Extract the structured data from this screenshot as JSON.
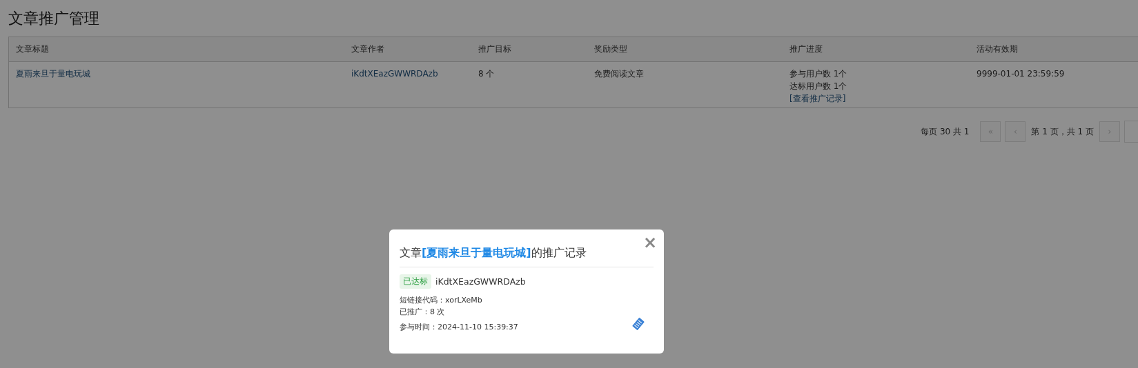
{
  "page_title": "文章推广管理",
  "table": {
    "columns": [
      "文章标题",
      "文章作者",
      "推广目标",
      "奖励类型",
      "推广进度",
      "活动有效期"
    ],
    "rows": [
      {
        "title": "夏雨来旦于量电玩城",
        "author": "iKdtXEazGWWRDAzb",
        "target": "8 个",
        "reward": "免费阅读文章",
        "progress": [
          "参与用户数 1个",
          "达标用户数 1个"
        ],
        "progress_link": "[查看推广记录]",
        "valid_until": "9999-01-01 23:59:59"
      }
    ]
  },
  "pagination": {
    "summary": "每页 30 共 1",
    "items": [
      {
        "kind": "button",
        "label": "«",
        "disabled": true
      },
      {
        "kind": "button",
        "label": "‹",
        "disabled": true
      },
      {
        "kind": "text",
        "label": "第 1 页，共 1 页"
      },
      {
        "kind": "button",
        "label": "›",
        "disabled": true
      },
      {
        "kind": "edge"
      }
    ]
  },
  "modal": {
    "title_prefix": "文章",
    "title_link": "[夏雨来旦于量电玩城]",
    "title_suffix": "的推广记录",
    "close": "×",
    "records": [
      {
        "badge": "已达标",
        "user": "iKdtXEazGWWRDAzb",
        "lines": [
          "短链接代码：xorLXeMb",
          "已推广：8 次"
        ],
        "time": "参与时间：2024-11-10 15:39:37"
      }
    ]
  }
}
